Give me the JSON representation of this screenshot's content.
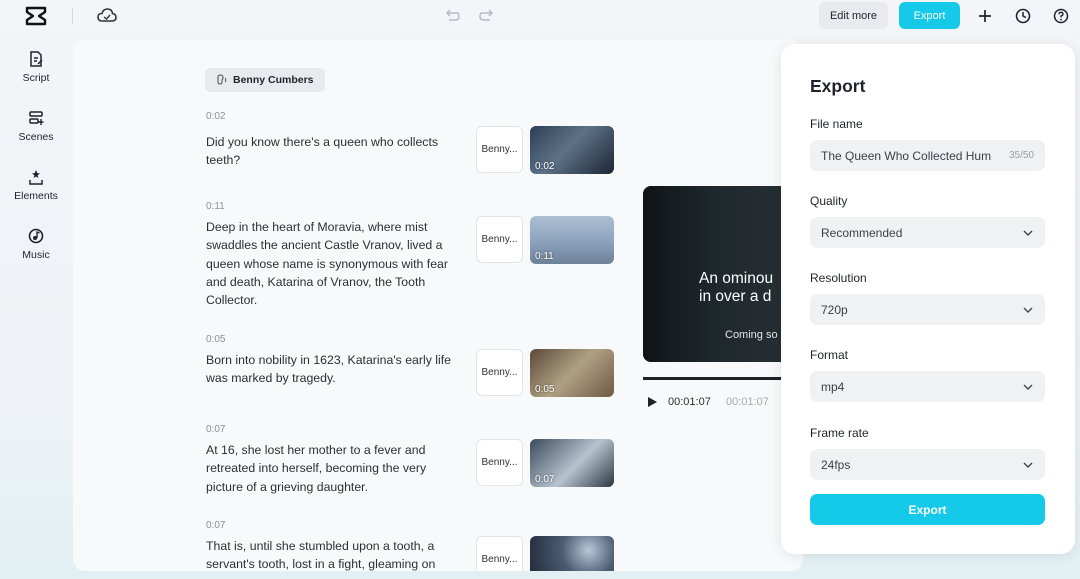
{
  "topbar": {
    "edit_more_label": "Edit more",
    "export_label": "Export"
  },
  "rail": [
    {
      "label": "Script",
      "icon": "script-icon"
    },
    {
      "label": "Scenes",
      "icon": "scenes-icon"
    },
    {
      "label": "Elements",
      "icon": "elements-icon"
    },
    {
      "label": "Music",
      "icon": "music-icon"
    }
  ],
  "speaker": {
    "name": "Benny Cumbers"
  },
  "scenes": [
    {
      "time": "0:02",
      "text": "Did you know there's a queen who collects teeth?",
      "voice": "Benny...",
      "thumb_time": "0:02"
    },
    {
      "time": "0:11",
      "text": "Deep in the heart of Moravia, where mist swaddles the ancient Castle Vranov, lived a queen whose name is synonymous with fear and death, Katarina of Vranov, the Tooth Collector.",
      "voice": "Benny...",
      "thumb_time": "0:11"
    },
    {
      "time": "0:05",
      "text": "Born into nobility in 1623, Katarina's early life was marked by tragedy.",
      "voice": "Benny...",
      "thumb_time": "0:05"
    },
    {
      "time": "0:07",
      "text": "At 16, she lost her mother to a fever and retreated into herself, becoming the very picture of a grieving daughter.",
      "voice": "Benny...",
      "thumb_time": "0:07"
    },
    {
      "time": "0:07",
      "text": "That is, until she stumbled upon a tooth, a servant's tooth, lost in a fight, gleaming on",
      "voice": "Benny...",
      "thumb_time": ""
    }
  ],
  "preview": {
    "title_line1": "An ominou",
    "title_line2": "in over a d",
    "subtitle": "Coming so",
    "current_time": "00:01:07",
    "total_time": "00:01:07"
  },
  "export": {
    "title": "Export",
    "file_name_label": "File name",
    "file_name_value": "The Queen Who Collected Hum",
    "file_name_count": "35/50",
    "quality_label": "Quality",
    "quality_value": "Recommended",
    "resolution_label": "Resolution",
    "resolution_value": "720p",
    "format_label": "Format",
    "format_value": "mp4",
    "frame_rate_label": "Frame rate",
    "frame_rate_value": "24fps",
    "export_button": "Export"
  },
  "colors": {
    "accent": "#14cae8",
    "panel": "#ffffff",
    "chip": "#e8eaed"
  }
}
